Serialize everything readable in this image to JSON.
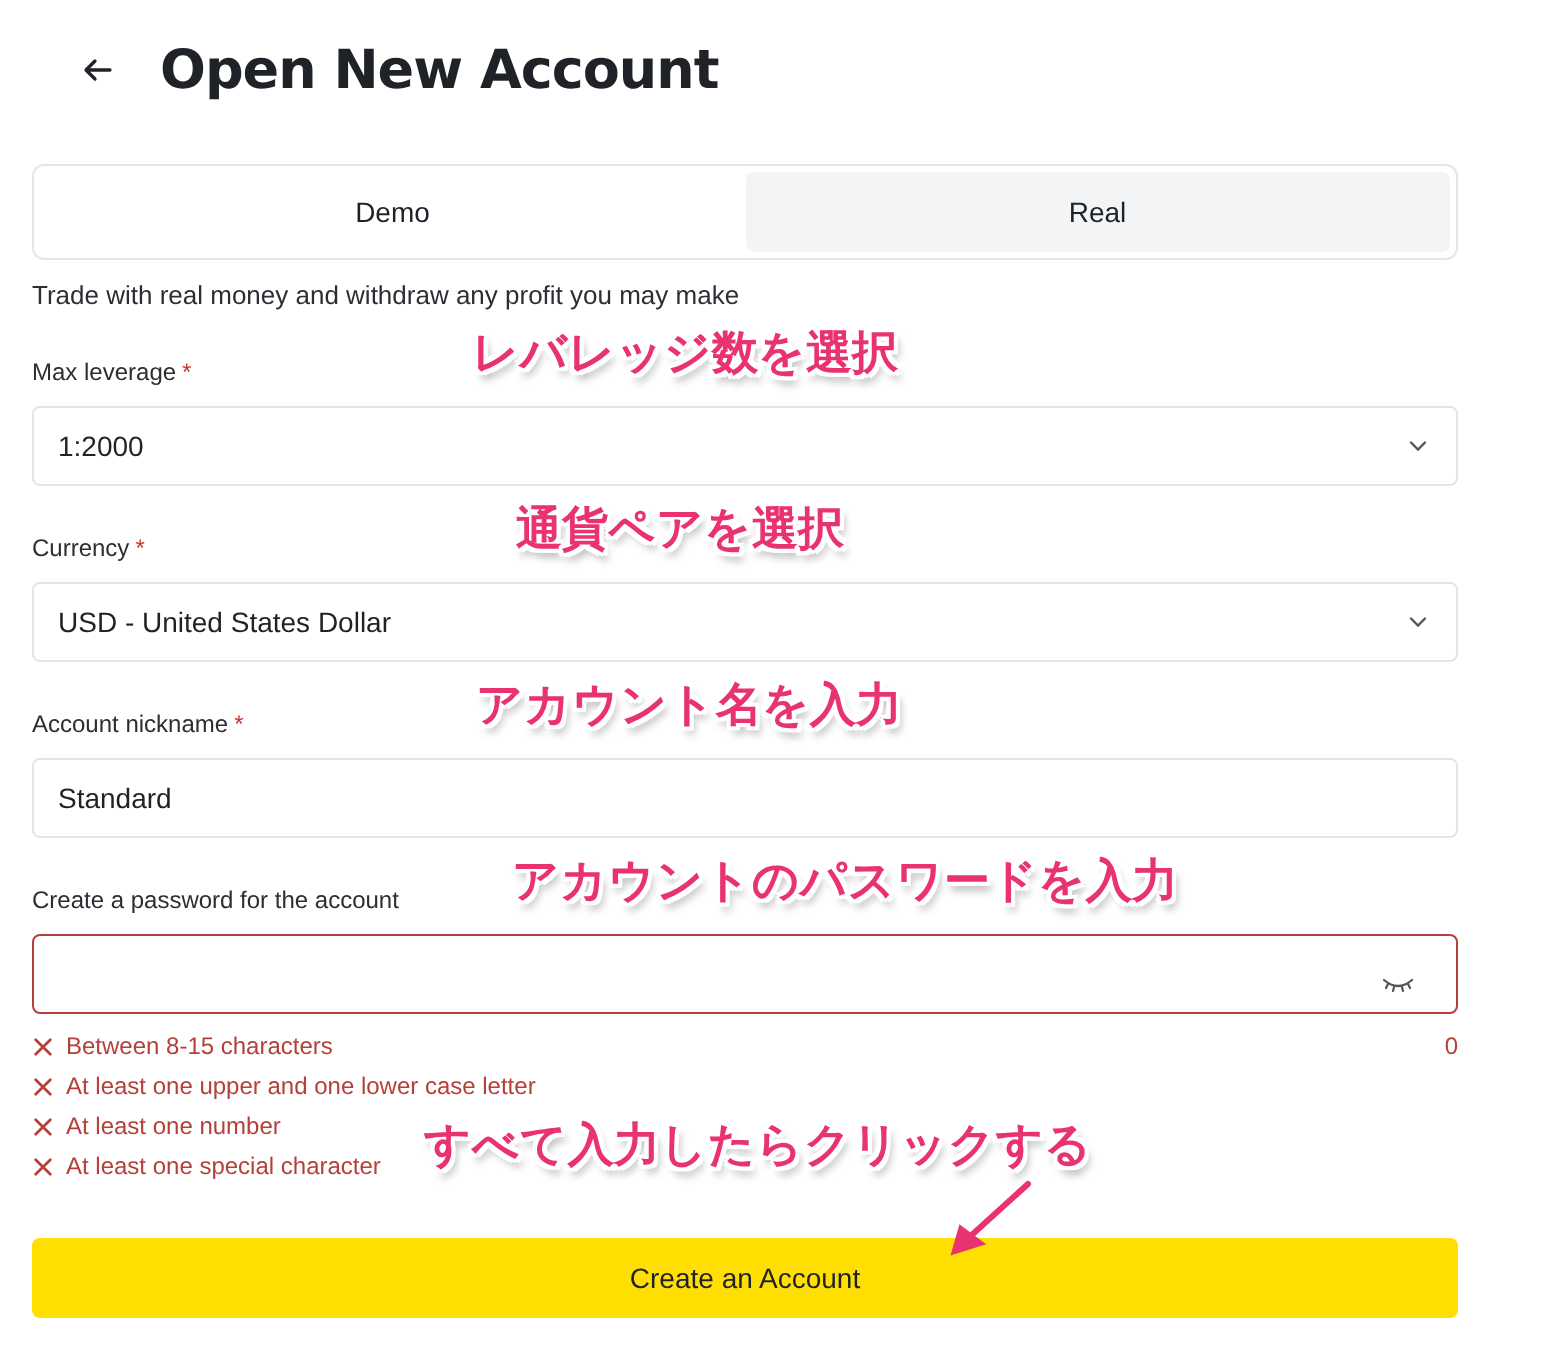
{
  "header": {
    "title": "Open New Account"
  },
  "tabs": [
    {
      "label": "Demo",
      "selected": false
    },
    {
      "label": "Real",
      "selected": true
    }
  ],
  "description": "Trade with real money and withdraw any profit you may make",
  "fields": [
    {
      "kind": "select",
      "label": "Max leverage",
      "required_mark": "*",
      "value": "1:2000",
      "annotation": "レバレッジ数を選択"
    },
    {
      "kind": "select",
      "label": "Currency",
      "required_mark": "*",
      "value": "USD - United States Dollar",
      "annotation": "通貨ペアを選択"
    },
    {
      "kind": "text",
      "label": "Account nickname",
      "required_mark": "*",
      "value": "Standard",
      "annotation": "アカウント名を入力"
    },
    {
      "kind": "password",
      "label": "Create a password for the account",
      "error": true,
      "annotation": "アカウントのパスワードを入力"
    }
  ],
  "password_rules": [
    {
      "text": "Between 8-15 characters",
      "met": false
    },
    {
      "text": "At least one upper and one lower case letter",
      "met": false
    },
    {
      "text": "At least one number",
      "met": false
    },
    {
      "text": "At least one special character",
      "met": false
    }
  ],
  "password_length": "0",
  "submit": {
    "label": "Create an Account",
    "annotation": "すべて入力したらクリックする"
  }
}
